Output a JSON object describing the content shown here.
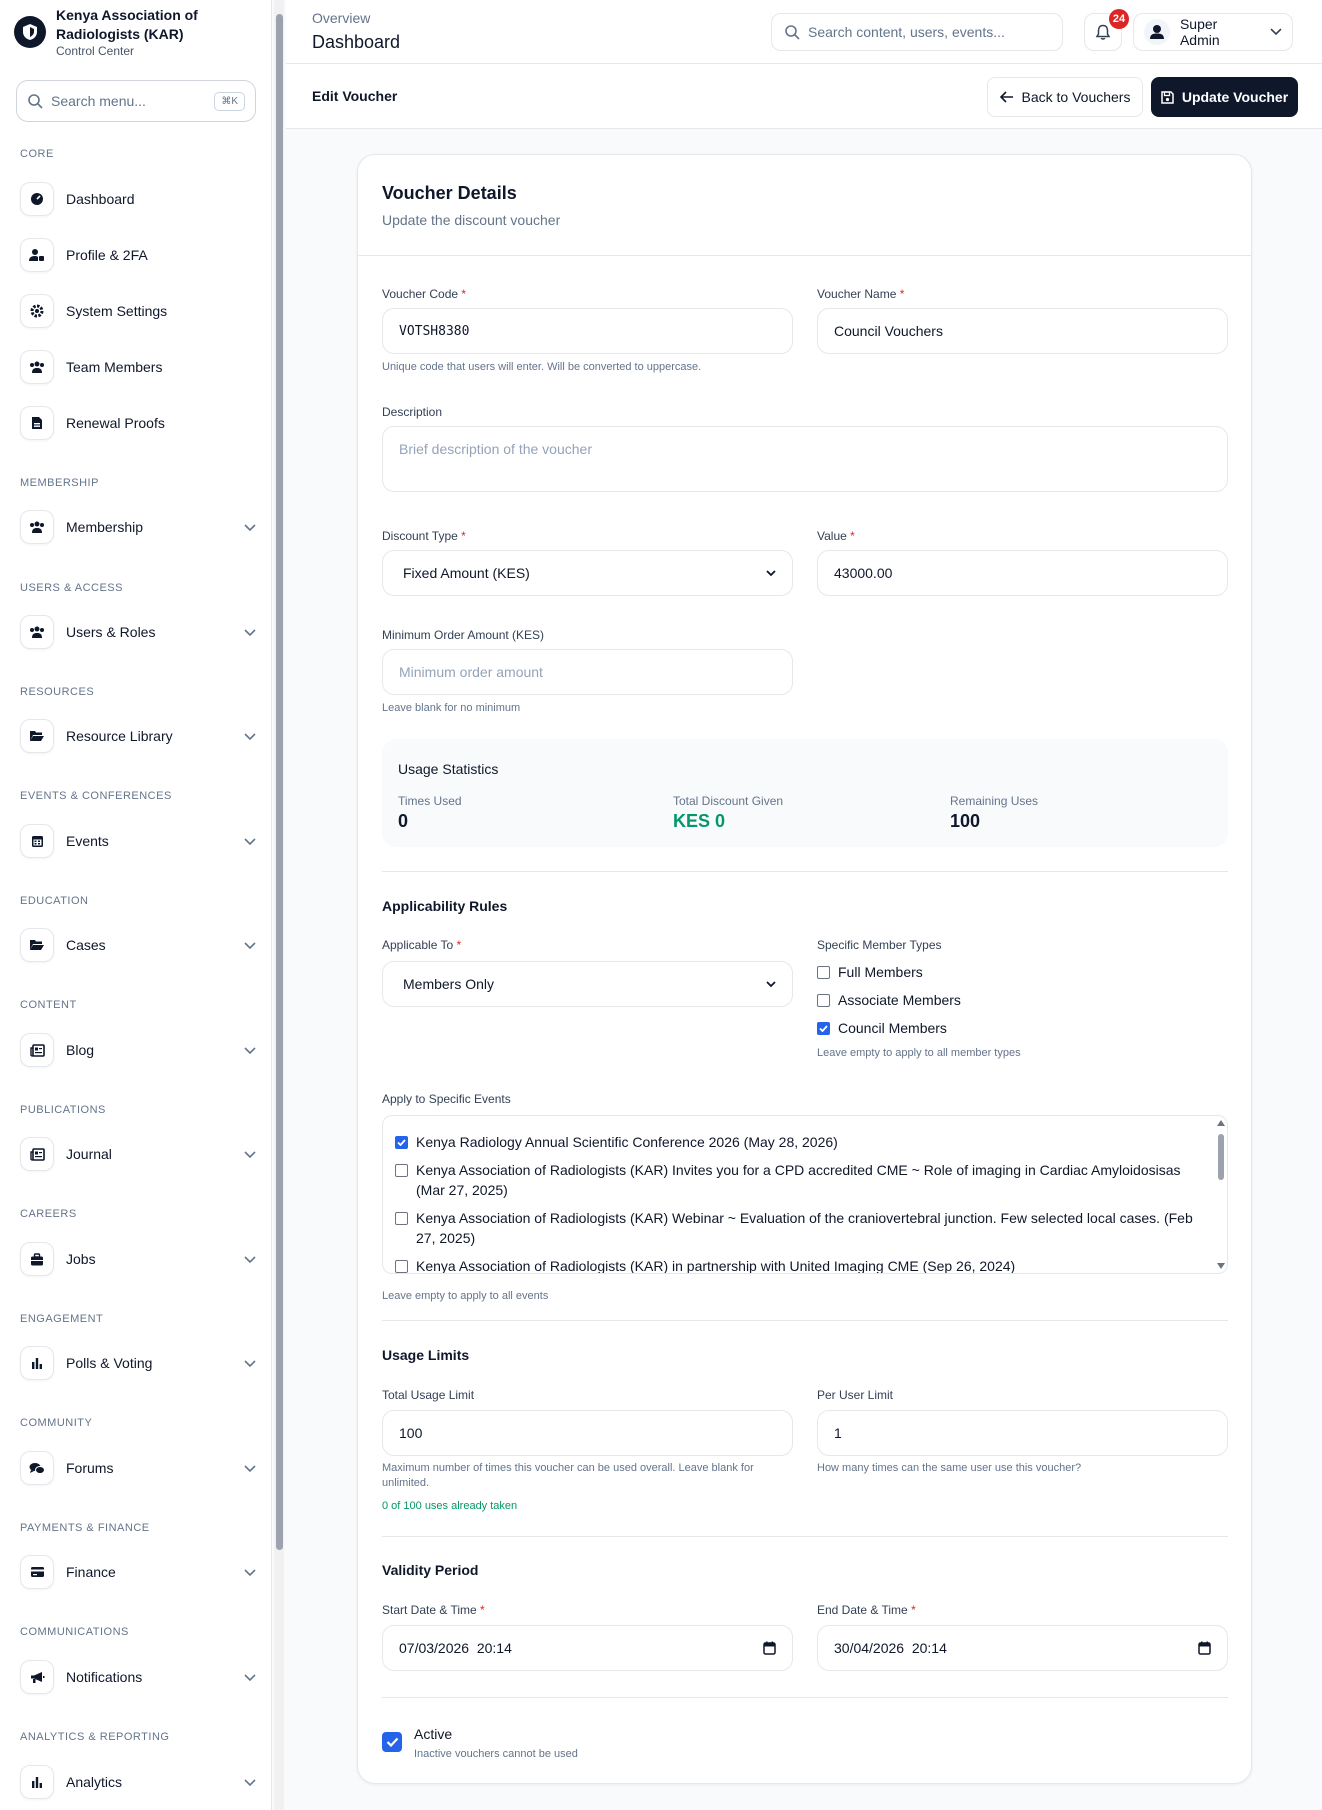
{
  "brand": {
    "name": "Kenya Association of Radiologists (KAR)",
    "subtitle": "Control Center"
  },
  "sidebar": {
    "search_placeholder": "Search menu...",
    "shortcut": "⌘K",
    "sections": {
      "core": "CORE",
      "membership": "MEMBERSHIP",
      "users_access": "USERS & ACCESS",
      "resources": "RESOURCES",
      "events": "EVENTS & CONFERENCES",
      "education": "EDUCATION",
      "content": "CONTENT",
      "publications": "PUBLICATIONS",
      "careers": "CAREERS",
      "engagement": "ENGAGEMENT",
      "community": "COMMUNITY",
      "payments": "PAYMENTS & FINANCE",
      "communications": "COMMUNICATIONS",
      "analytics": "ANALYTICS & REPORTING"
    },
    "items": {
      "dashboard": "Dashboard",
      "profile": "Profile & 2FA",
      "settings": "System Settings",
      "team": "Team Members",
      "renewal": "Renewal Proofs",
      "membership": "Membership",
      "users": "Users & Roles",
      "resources": "Resource Library",
      "events": "Events",
      "cases": "Cases",
      "blog": "Blog",
      "journal": "Journal",
      "jobs": "Jobs",
      "polls": "Polls & Voting",
      "forums": "Forums",
      "finance": "Finance",
      "notifications": "Notifications",
      "analytics": "Analytics"
    }
  },
  "topbar": {
    "breadcrumb": "Overview",
    "title": "Dashboard",
    "search_placeholder": "Search content, users, events...",
    "notif_count": "24",
    "user_name": "Super Admin"
  },
  "subbar": {
    "title": "Edit Voucher",
    "back_label": "Back to Vouchers",
    "update_label": "Update Voucher"
  },
  "card": {
    "title": "Voucher Details",
    "subtitle": "Update the discount voucher"
  },
  "form": {
    "code_label": "Voucher Code",
    "code_value": "VOTSH8380",
    "code_help": "Unique code that users will enter. Will be converted to uppercase.",
    "name_label": "Voucher Name",
    "name_value": "Council Vouchers",
    "desc_label": "Description",
    "desc_placeholder": "Brief description of the voucher",
    "dtype_label": "Discount Type",
    "dtype_value": "Fixed Amount (KES)",
    "value_label": "Value",
    "value_value": "43000.00",
    "min_label": "Minimum Order Amount (KES)",
    "min_placeholder": "Minimum order amount",
    "min_help": "Leave blank for no minimum"
  },
  "stats": {
    "title": "Usage Statistics",
    "times_used_label": "Times Used",
    "times_used": "0",
    "total_discount_label": "Total Discount Given",
    "total_discount": "KES 0",
    "remaining_label": "Remaining Uses",
    "remaining": "100"
  },
  "applicability": {
    "title": "Applicability Rules",
    "applicable_label": "Applicable To",
    "applicable_value": "Members Only",
    "member_types_label": "Specific Member Types",
    "member_types": [
      "Full Members",
      "Associate Members",
      "Council Members"
    ],
    "member_types_checked": [
      false,
      false,
      true
    ],
    "member_types_help": "Leave empty to apply to all member types",
    "events_label": "Apply to Specific Events",
    "events": [
      "Kenya Radiology Annual Scientific Conference 2026 (May 28, 2026)",
      "Kenya Association of Radiologists (KAR) Invites you for a CPD accredited CME ~ Role of imaging in Cardiac Amyloidosisas (Mar 27, 2025)",
      "Kenya Association of Radiologists (KAR) Webinar ~ Evaluation of the craniovertebral junction. Few selected local cases. (Feb 27, 2025)",
      "Kenya Association of Radiologists (KAR) in partnership with United Imaging CME (Sep 26, 2024)"
    ],
    "events_checked": [
      true,
      false,
      false,
      false
    ],
    "events_help": "Leave empty to apply to all events"
  },
  "limits": {
    "title": "Usage Limits",
    "total_label": "Total Usage Limit",
    "total_value": "100",
    "total_help": "Maximum number of times this voucher can be used overall. Leave blank for unlimited.",
    "taken": "0 of 100 uses already taken",
    "per_user_label": "Per User Limit",
    "per_user_value": "1",
    "per_user_help": "How many times can the same user use this voucher?"
  },
  "validity": {
    "title": "Validity Period",
    "start_label": "Start Date & Time",
    "start_value": "07/03/2026  20:14",
    "end_label": "End Date & Time",
    "end_value": "30/04/2026  20:14"
  },
  "active": {
    "label": "Active",
    "help": "Inactive vouchers cannot be used"
  },
  "colors": {
    "accent": "#0f172a",
    "primary": "#2563eb",
    "success": "#059669",
    "danger": "#dc2626"
  }
}
